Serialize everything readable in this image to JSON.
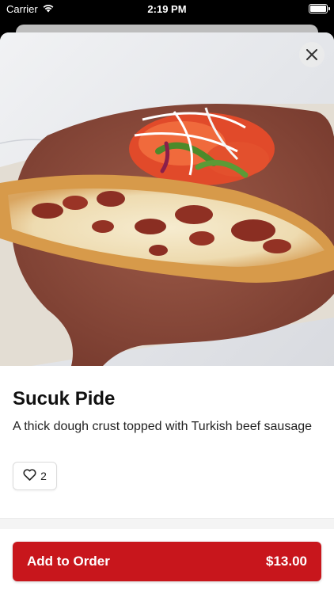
{
  "status_bar": {
    "carrier": "Carrier",
    "time": "2:19 PM",
    "icons": [
      "wifi-icon",
      "battery-icon"
    ]
  },
  "item": {
    "name": "Sucuk Pide",
    "description": "A thick dough crust topped with Turkish beef sausage",
    "like_count": "2",
    "image_alt": "Sucuk pide with salad on a wooden board"
  },
  "footer": {
    "button_label": "Add to Order",
    "price": "$13.00"
  },
  "colors": {
    "accent": "#c8161c"
  },
  "icons": {
    "close": "close-icon",
    "like": "heart-icon"
  }
}
